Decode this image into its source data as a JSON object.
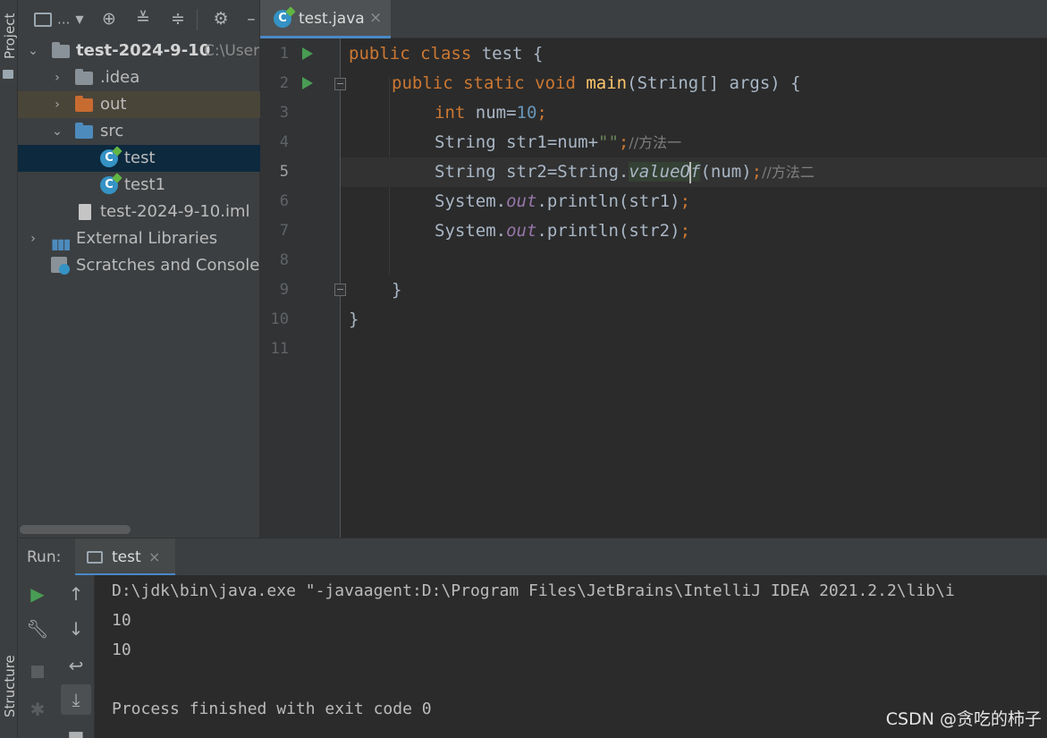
{
  "side_tabs": {
    "project": "Project",
    "structure": "Structure"
  },
  "project_toolbar": {
    "dropdown_label": "...",
    "minimize": "–"
  },
  "project_tree": {
    "root": {
      "name": "test-2024-9-10",
      "path": "C:\\User"
    },
    "items": [
      {
        "label": ".idea",
        "type": "folder"
      },
      {
        "label": "out",
        "type": "folder"
      },
      {
        "label": "src",
        "type": "folder"
      },
      {
        "label": "test",
        "type": "class"
      },
      {
        "label": "test1",
        "type": "class"
      },
      {
        "label": "test-2024-9-10.iml",
        "type": "file"
      },
      {
        "label": "External Libraries",
        "type": "library"
      },
      {
        "label": "Scratches and Consoles",
        "type": "scratches"
      }
    ]
  },
  "editor": {
    "tab": {
      "label": "test.java",
      "close": "×"
    },
    "line_numbers": [
      "1",
      "2",
      "3",
      "4",
      "5",
      "6",
      "7",
      "8",
      "9",
      "10",
      "11"
    ],
    "current_line": 5,
    "code": {
      "l1": {
        "kw1": "public ",
        "kw2": "class ",
        "rest": "test {"
      },
      "l2": {
        "kw1": "public ",
        "kw2": "static ",
        "kw3": "void ",
        "fn": "main",
        "rest": "(String[] args) {"
      },
      "l3": {
        "kw": "int ",
        "name": "num=",
        "num": "10",
        "semi": ";"
      },
      "l4": {
        "text": "String str1=num+",
        "str": "\"\"",
        "semi": ";",
        "comment": "//方法一"
      },
      "l5": {
        "text": "String str2=String.",
        "method_a": "value",
        "method_b": "Of",
        "args": "(num)",
        "semi": ";",
        "comment": "//方法二"
      },
      "l6": {
        "text": "System.",
        "fld": "out",
        "call": ".println(str1)",
        "semi": ";"
      },
      "l7": {
        "text": "System.",
        "fld": "out",
        "call": ".println(str2)",
        "semi": ";"
      },
      "l9": {
        "text": "}"
      },
      "l10": {
        "text": "}"
      }
    }
  },
  "run_panel": {
    "label": "Run:",
    "tab_label": "test",
    "tab_close": "×",
    "console_lines": [
      "D:\\jdk\\bin\\java.exe \"-javaagent:D:\\Program Files\\JetBrains\\IntelliJ IDEA 2021.2.2\\lib\\i",
      "10",
      "10",
      "",
      "Process finished with exit code 0"
    ]
  },
  "watermark": "CSDN @贪吃的柿子",
  "colors": {
    "keyword": "#cc7832",
    "function": "#ffc66d",
    "number": "#6897bb",
    "string": "#6a8759",
    "comment": "#808080",
    "field": "#9876aa",
    "run_green": "#499c54",
    "selection": "#0d293e",
    "accent": "#4a88c7"
  }
}
